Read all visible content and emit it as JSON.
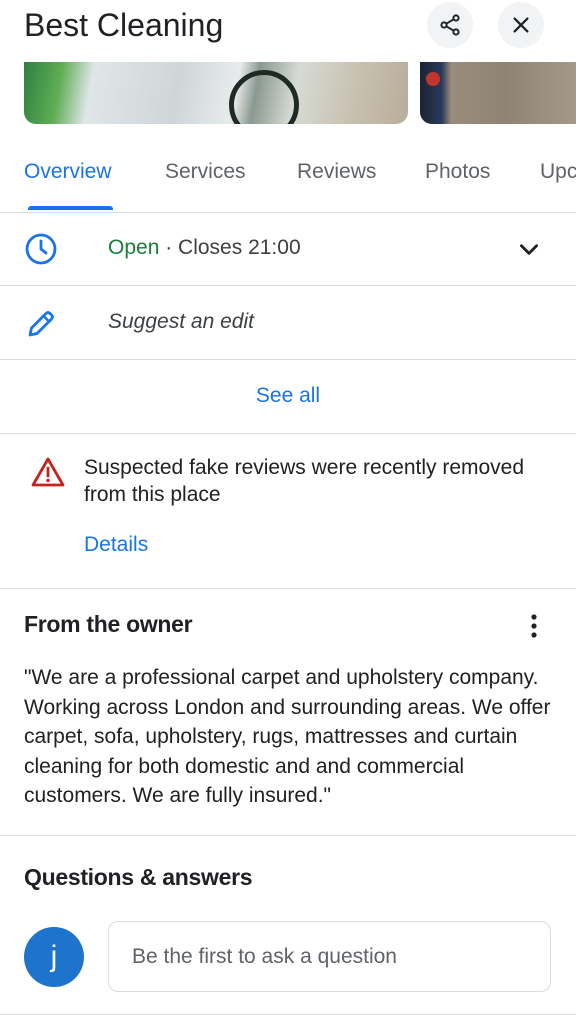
{
  "place": {
    "name": "Best Cleaning"
  },
  "header": {
    "share_icon": "share-icon",
    "close_icon": "close-icon"
  },
  "tabs": [
    {
      "label": "Overview",
      "active": true
    },
    {
      "label": "Services"
    },
    {
      "label": "Reviews"
    },
    {
      "label": "Photos"
    },
    {
      "label": "Upc"
    }
  ],
  "hours": {
    "status": "Open",
    "separator": " · ",
    "closes": "Closes 21:00",
    "icon": "clock-icon"
  },
  "edit": {
    "label": "Suggest an edit",
    "icon": "pencil-icon"
  },
  "see_all": {
    "label": "See all"
  },
  "warning": {
    "text": "Suspected fake reviews were recently removed from this place",
    "details_label": "Details",
    "icon": "warning-icon"
  },
  "owner": {
    "heading": "From the owner",
    "text": "\"We are a professional carpet and upholstery company. Working across London and surrounding areas. We offer carpet, sofa, upholstery, rugs, mattresses and curtain cleaning for both domestic and and commercial customers. We are fully insured.\""
  },
  "qa": {
    "heading": "Questions & answers",
    "avatar_letter": "j",
    "placeholder": "Be the first to ask a question"
  },
  "colors": {
    "accent": "#1a73e8",
    "open": "#188038",
    "warning": "#c5221f",
    "avatar": "#1e74cc"
  }
}
